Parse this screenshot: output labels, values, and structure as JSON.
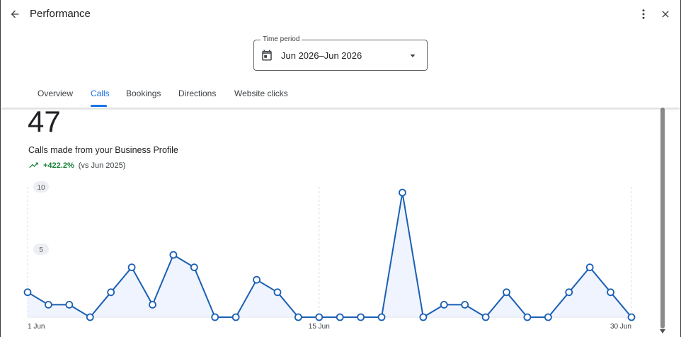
{
  "header": {
    "title": "Performance",
    "back_icon": "arrow-back-icon",
    "more_icon": "more-vert-icon",
    "close_icon": "close-icon"
  },
  "time_period": {
    "label": "Time period",
    "value": "Jun 2026–Jun 2026",
    "icon": "calendar-icon",
    "caret_icon": "arrow-drop-down-icon"
  },
  "tabs": [
    {
      "label": "Overview",
      "active": false
    },
    {
      "label": "Calls",
      "active": true
    },
    {
      "label": "Bookings",
      "active": false
    },
    {
      "label": "Directions",
      "active": false
    },
    {
      "label": "Website clicks",
      "active": false
    }
  ],
  "metric": {
    "value": "47",
    "description": "Calls made from your Business Profile",
    "change": "+422.2%",
    "comparison": "(vs Jun 2025)",
    "trend_icon": "trending-up-icon"
  },
  "colors": {
    "accent": "#1a73e8",
    "line": "#1a5fb4",
    "positive": "#188038"
  },
  "chart_data": {
    "type": "line",
    "title": "",
    "xlabel": "",
    "ylabel": "",
    "x": [
      "1 Jun",
      "2 Jun",
      "3 Jun",
      "4 Jun",
      "5 Jun",
      "6 Jun",
      "7 Jun",
      "8 Jun",
      "9 Jun",
      "10 Jun",
      "11 Jun",
      "12 Jun",
      "13 Jun",
      "14 Jun",
      "15 Jun",
      "16 Jun",
      "17 Jun",
      "18 Jun",
      "19 Jun",
      "20 Jun",
      "21 Jun",
      "22 Jun",
      "23 Jun",
      "24 Jun",
      "25 Jun",
      "26 Jun",
      "27 Jun",
      "28 Jun",
      "29 Jun",
      "30 Jun"
    ],
    "series": [
      {
        "values": [
          2,
          1,
          1,
          0,
          2,
          4,
          1,
          5,
          4,
          0,
          0,
          3,
          2,
          0,
          0,
          0,
          0,
          0,
          10,
          0,
          1,
          1,
          0,
          2,
          0,
          0,
          2,
          4,
          2,
          0
        ]
      }
    ],
    "y_ticks": [
      "5",
      "10"
    ],
    "x_ticks": [
      {
        "index": 0,
        "label": "1 Jun"
      },
      {
        "index": 14,
        "label": "15 Jun"
      },
      {
        "index": 29,
        "label": "30 Jun"
      }
    ],
    "ylim": [
      0,
      10
    ],
    "grid": true,
    "legend": "none"
  }
}
